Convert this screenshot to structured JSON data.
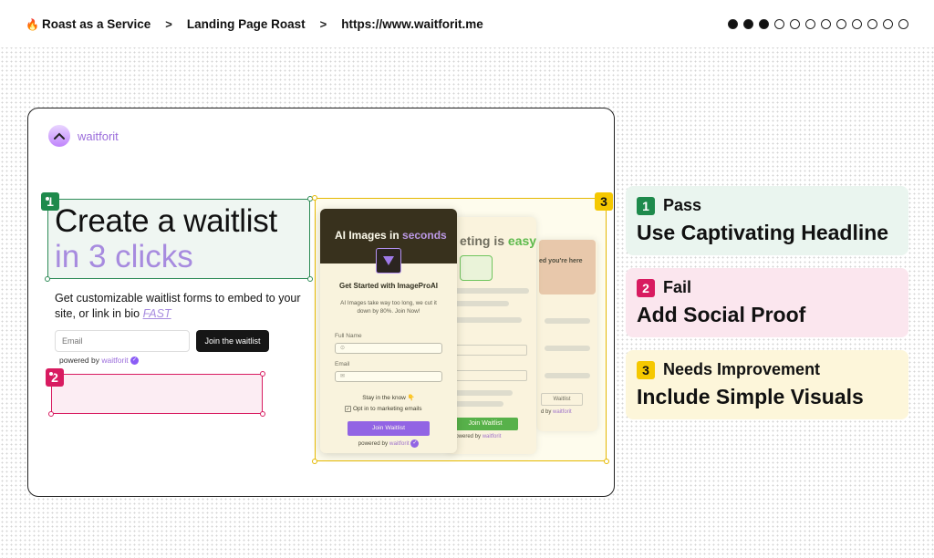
{
  "breadcrumb": {
    "items": [
      "Roast as a Service",
      "Landing Page Roast",
      "https://www.waitforit.me"
    ],
    "separator": ">",
    "flame_icon": "flame-icon"
  },
  "progress": {
    "total": 12,
    "current": 3
  },
  "landing": {
    "logo_text": "waitforit",
    "headline_line1": "Create a waitlist",
    "headline_line2": "in 3 clicks",
    "subtext": "Get customizable waitlist forms to embed to your site, or link in bio",
    "subtext_emphasis": "FAST",
    "email_placeholder": "Email",
    "join_button": "Join the waitlist",
    "powered_prefix": "powered by",
    "powered_brand": "waitforit",
    "form_front": {
      "title_prefix": "AI Images in",
      "title_accent": "seconds",
      "heading": "Get Started with ImageProAI",
      "description": "AI Images take way too long, we cut it down by 80%. Join Now!",
      "name_label": "Full Name",
      "email_label": "Email",
      "stay_text": "Stay in the know",
      "stay_emoji": "👇",
      "opt_in_text": "Opt in to marketing emails",
      "button": "Join Waitlist",
      "powered_prefix": "powered by",
      "powered_brand": "waitforit"
    },
    "form_back": {
      "title_prefix": "eting is",
      "title_accent": "easy",
      "button": "Join Waitlist",
      "powered_text": "powered by",
      "powered_brand": "waitforit"
    },
    "form_back2": {
      "text": "ed you're here",
      "button": "Waitlist",
      "powered_text": "d by",
      "powered_brand": "waitforit"
    }
  },
  "annotations": {
    "box1_number": "1",
    "box2_number": "2",
    "box3_number": "3"
  },
  "results": [
    {
      "number": "1",
      "status": "Pass",
      "title": "Use Captivating Headline",
      "color": "#1e8a4c"
    },
    {
      "number": "2",
      "status": "Fail",
      "title": "Add Social Proof",
      "color": "#d81b60"
    },
    {
      "number": "3",
      "status": "Needs Improvement",
      "title": "Include Simple Visuals",
      "color": "#f5c800"
    }
  ]
}
